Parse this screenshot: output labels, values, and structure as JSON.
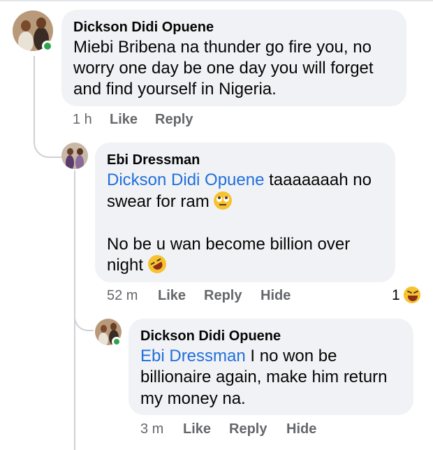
{
  "comments": [
    {
      "author": "Dickson Didi Opuene",
      "text_lines": [
        "Miebi Bribena na thunder go fire you, no",
        "worry one day be one day you will forget",
        "and find yourself in Nigeria."
      ],
      "time": "1 h",
      "actions": {
        "like": "Like",
        "reply": "Reply"
      }
    },
    {
      "author": "Ebi Dressman",
      "mention": "Dickson Didi Opuene",
      "line1_rest": " taaaaaaah no",
      "line2": "swear for ram",
      "line3": "No be u wan become billion over",
      "line4": "night",
      "time": "52 m",
      "actions": {
        "like": "Like",
        "reply": "Reply",
        "hide": "Hide"
      },
      "reaction_count": "1"
    },
    {
      "author": "Dickson Didi Opuene",
      "mention": "Ebi Dressman",
      "line1_rest": " I no won be",
      "line2": "billionaire again, make him return",
      "line3": "my money na.",
      "time": "3 m",
      "actions": {
        "like": "Like",
        "reply": "Reply",
        "hide": "Hide"
      }
    }
  ],
  "icons": {
    "eyeroll_emoji": "face-with-rolling-eyes-icon",
    "laughing_emoji": "rolling-on-floor-laughing-icon",
    "reaction": "laughing-reaction-icon"
  },
  "colors": {
    "mention": "#216fdb",
    "bubble": "#f0f2f5",
    "meta": "#65676b",
    "online": "#31a24c"
  }
}
